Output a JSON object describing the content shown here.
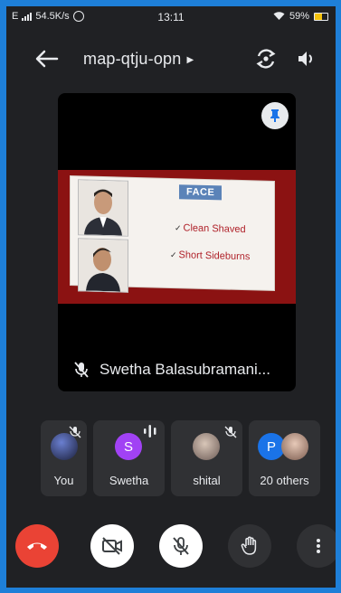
{
  "status": {
    "network": "E",
    "speed": "54.5K/s",
    "time": "13:11",
    "battery": "59%"
  },
  "meeting": {
    "code": "map-qtju-opn"
  },
  "main_tile": {
    "presenter_name": "Swetha Balasubramani...",
    "slide": {
      "heading": "FACE",
      "points": [
        "Clean Shaved",
        "Short Sideburns"
      ]
    }
  },
  "participants": [
    {
      "label": "You",
      "muted": true
    },
    {
      "label": "Swetha",
      "avatar_letter": "S",
      "avatar_color": "#a142f4",
      "speaking": true
    },
    {
      "label": "shital",
      "muted": true
    },
    {
      "label": "20 others",
      "avatar_letter": "P",
      "avatar_color": "#1a73e8"
    }
  ],
  "controls": [
    "end-call",
    "camera-off",
    "mic-off",
    "raise-hand",
    "more-options"
  ],
  "colors": {
    "accent_blue": "#1e7fd8",
    "end_call_red": "#ea4335",
    "background": "#202124",
    "tile_gray": "#303134"
  }
}
